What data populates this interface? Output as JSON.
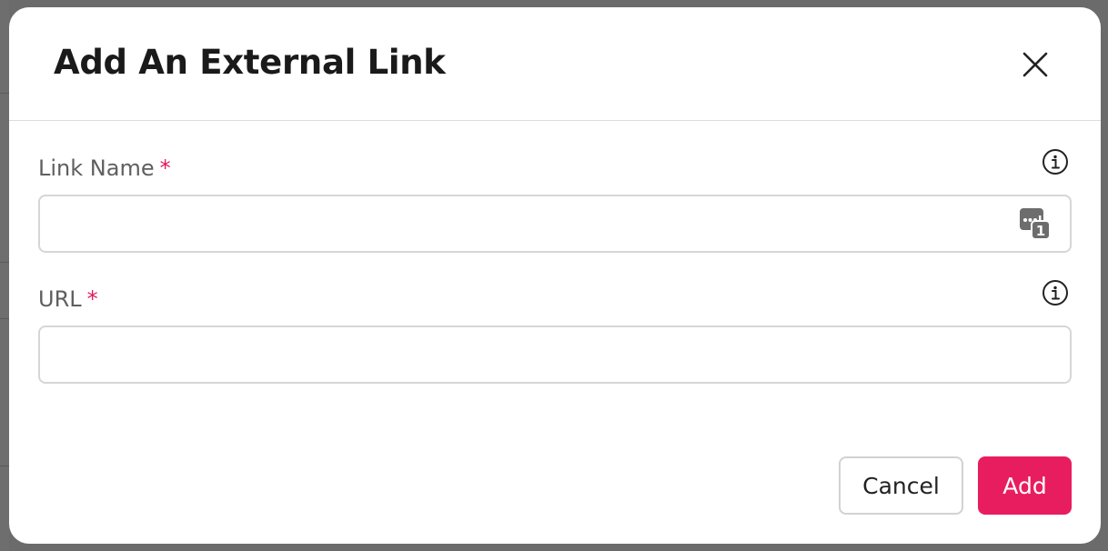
{
  "dialog": {
    "title": "Add An External Link",
    "close_icon": "close-icon"
  },
  "fields": [
    {
      "label": "Link Name",
      "required_mark": "*",
      "value": "",
      "placeholder": "",
      "info_icon": "info-icon",
      "addon_icon": "password-manager-icon",
      "addon_badge": "1"
    },
    {
      "label": "URL",
      "required_mark": "*",
      "value": "",
      "placeholder": "",
      "info_icon": "info-icon"
    }
  ],
  "actions": {
    "cancel_label": "Cancel",
    "add_label": "Add"
  },
  "colors": {
    "accent": "#e81d5f",
    "required": "#e3185b",
    "backdrop": "#6b6b6b"
  }
}
